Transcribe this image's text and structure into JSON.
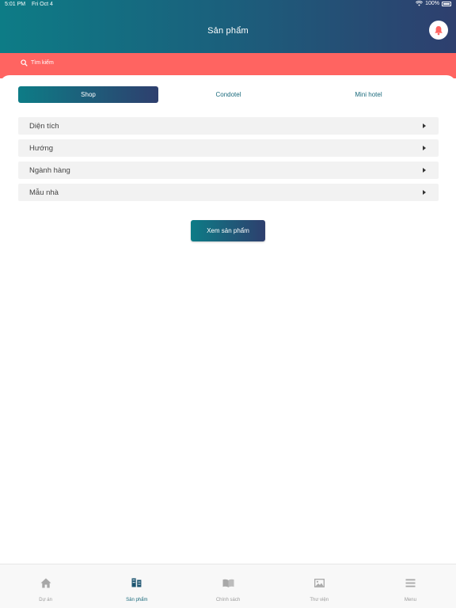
{
  "status": {
    "time": "5:01 PM",
    "date": "Fri Oct 4",
    "battery": "100%"
  },
  "header": {
    "title": "Sản phẩm"
  },
  "search": {
    "placeholder": "Tìm kiếm"
  },
  "tabs": [
    {
      "label": "Shop",
      "active": true
    },
    {
      "label": "Condotel",
      "active": false
    },
    {
      "label": "Mini hotel",
      "active": false
    }
  ],
  "filters": [
    {
      "label": "Diện tích"
    },
    {
      "label": "Hướng"
    },
    {
      "label": "Ngành hàng"
    },
    {
      "label": "Mẫu nhà"
    }
  ],
  "action": {
    "view_label": "Xem sản phẩm"
  },
  "tabbar": [
    {
      "label": "Dự án",
      "icon": "home-icon",
      "active": false
    },
    {
      "label": "Sản phẩm",
      "icon": "buildings-icon",
      "active": true
    },
    {
      "label": "Chính sách",
      "icon": "book-icon",
      "active": false
    },
    {
      "label": "Thư viện",
      "icon": "image-icon",
      "active": false
    },
    {
      "label": "Menu",
      "icon": "menu-icon",
      "active": false
    }
  ],
  "colors": {
    "primary_start": "#0d7c86",
    "primary_end": "#2e3f6e",
    "search_bg": "#ff6461",
    "bell": "#ff6461"
  }
}
